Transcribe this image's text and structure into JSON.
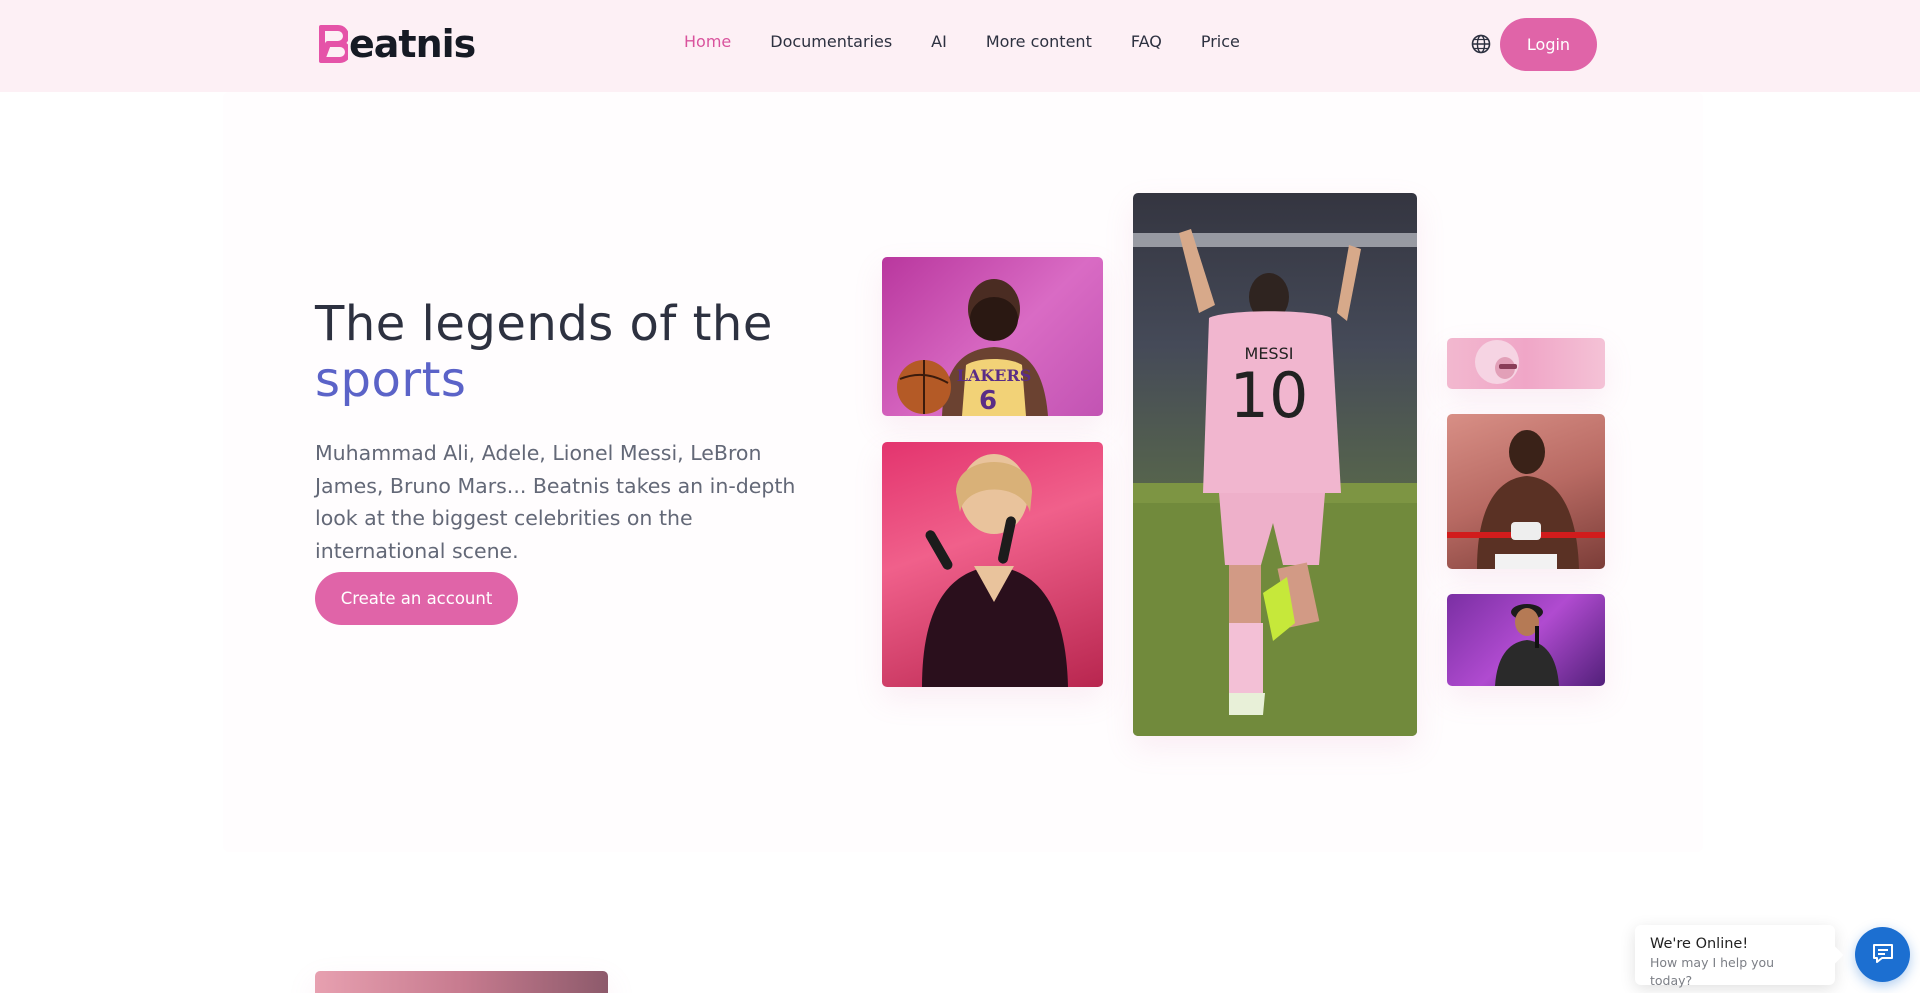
{
  "brand": {
    "name": "Beatnis",
    "logo_text": "eatnis",
    "accent": "#e064a8",
    "logo_color": "#e553a8"
  },
  "nav": {
    "items": [
      {
        "label": "Home",
        "active": true
      },
      {
        "label": "Documentaries",
        "active": false
      },
      {
        "label": "AI",
        "active": false
      },
      {
        "label": "More content",
        "active": false
      },
      {
        "label": "FAQ",
        "active": false
      },
      {
        "label": "Price",
        "active": false
      }
    ],
    "language_icon": "globe-icon",
    "login_label": "Login"
  },
  "hero": {
    "title_line1": "The legends of the",
    "title_accent": "sports",
    "description": "Muhammad Ali, Adele, Lionel Messi, LeBron James, Bruno Mars... Beatnis takes an in-depth look at the biggest celebrities on the international scene.",
    "cta_label": "Create an account",
    "title_accent_color": "#5b63c8"
  },
  "photos": {
    "lebron_jersey": "LAKERS",
    "lebron_number": "6",
    "messi_name": "MESSI",
    "messi_number": "10"
  },
  "chat": {
    "title": "We're Online!",
    "subtitle": "How may I help you today?",
    "icon": "chat-icon",
    "button_color": "#1c6fd1"
  }
}
